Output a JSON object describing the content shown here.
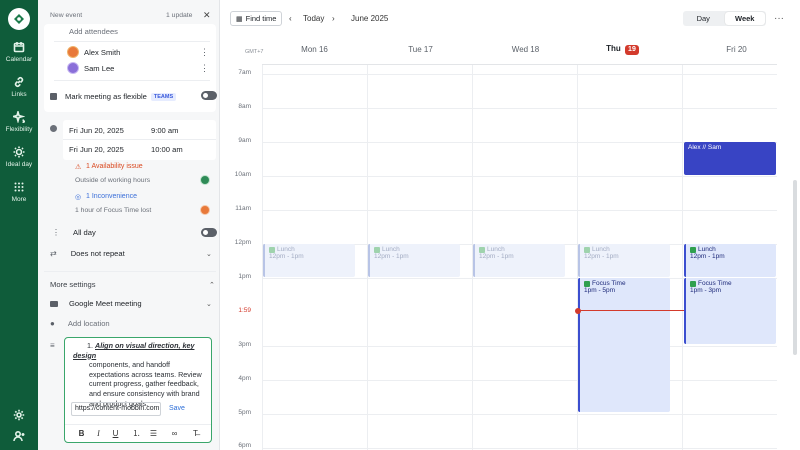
{
  "rail": {
    "items": [
      {
        "label": "Calendar",
        "icon": "calendar-icon"
      },
      {
        "label": "Links",
        "icon": "link-icon"
      },
      {
        "label": "Flexibility",
        "icon": "sparkle-icon"
      },
      {
        "label": "Ideal day",
        "icon": "sun-icon"
      },
      {
        "label": "More",
        "icon": "grid-icon"
      }
    ]
  },
  "panel": {
    "title": "New event",
    "update_badge": "1 update",
    "attendees_placeholder": "Add attendees",
    "attendees": [
      {
        "name": "Alex Smith",
        "color": "#e8793a"
      },
      {
        "name": "Sam Lee",
        "color": "#8a6fd9"
      }
    ],
    "flexible_label": "Mark meeting as flexible",
    "flexible_badge": "TEAMS",
    "start_date": "Fri Jun 20, 2025",
    "start_time": "9:00 am",
    "end_date": "Fri Jun 20, 2025",
    "end_time": "10:00 am",
    "availability_title": "1 Availability issue",
    "availability_detail": "Outside of working hours",
    "inconvenience_title": "1 Inconvenience",
    "inconvenience_detail": "1 hour of Focus Time lost",
    "all_day_label": "All day",
    "repeat_value": "Does not repeat",
    "more_settings": "More settings",
    "meeting_type": "Google Meet meeting",
    "location_placeholder": "Add location",
    "description_number": "1.",
    "description_bold": "Align on visual direction, key design",
    "description_rest": "components, and handoff expectations across teams. Review current progress, gather feedback, and ensure consistency with brand and product goals.",
    "link_value": "https://content-mobbin.com",
    "save_label": "Save"
  },
  "topbar": {
    "find_time": "Find time",
    "today": "Today",
    "month": "June 2025",
    "view_day": "Day",
    "view_week": "Week"
  },
  "calendar": {
    "timezone": "GMT+7",
    "days": [
      {
        "label": "Mon 16"
      },
      {
        "label": "Tue 17"
      },
      {
        "label": "Wed 18"
      },
      {
        "label": "Thu",
        "num": "19",
        "today": true
      },
      {
        "label": "Fri 20"
      }
    ],
    "hours": [
      "7am",
      "8am",
      "9am",
      "10am",
      "11am",
      "12pm",
      "1pm",
      "1:59",
      "3pm",
      "4pm",
      "5pm",
      "6pm"
    ],
    "events": {
      "lunch_title": "Lunch",
      "lunch_time": "12pm - 1pm",
      "focus_title": "Focus Time",
      "focus_thu_time": "1pm - 5pm",
      "focus_fri_time": "1pm - 3pm",
      "alex_title": "Alex // Sam"
    }
  },
  "colors": {
    "brand": "#0f5c3a",
    "today_accent": "#d33a2c",
    "event_primary": "#3844c4"
  }
}
